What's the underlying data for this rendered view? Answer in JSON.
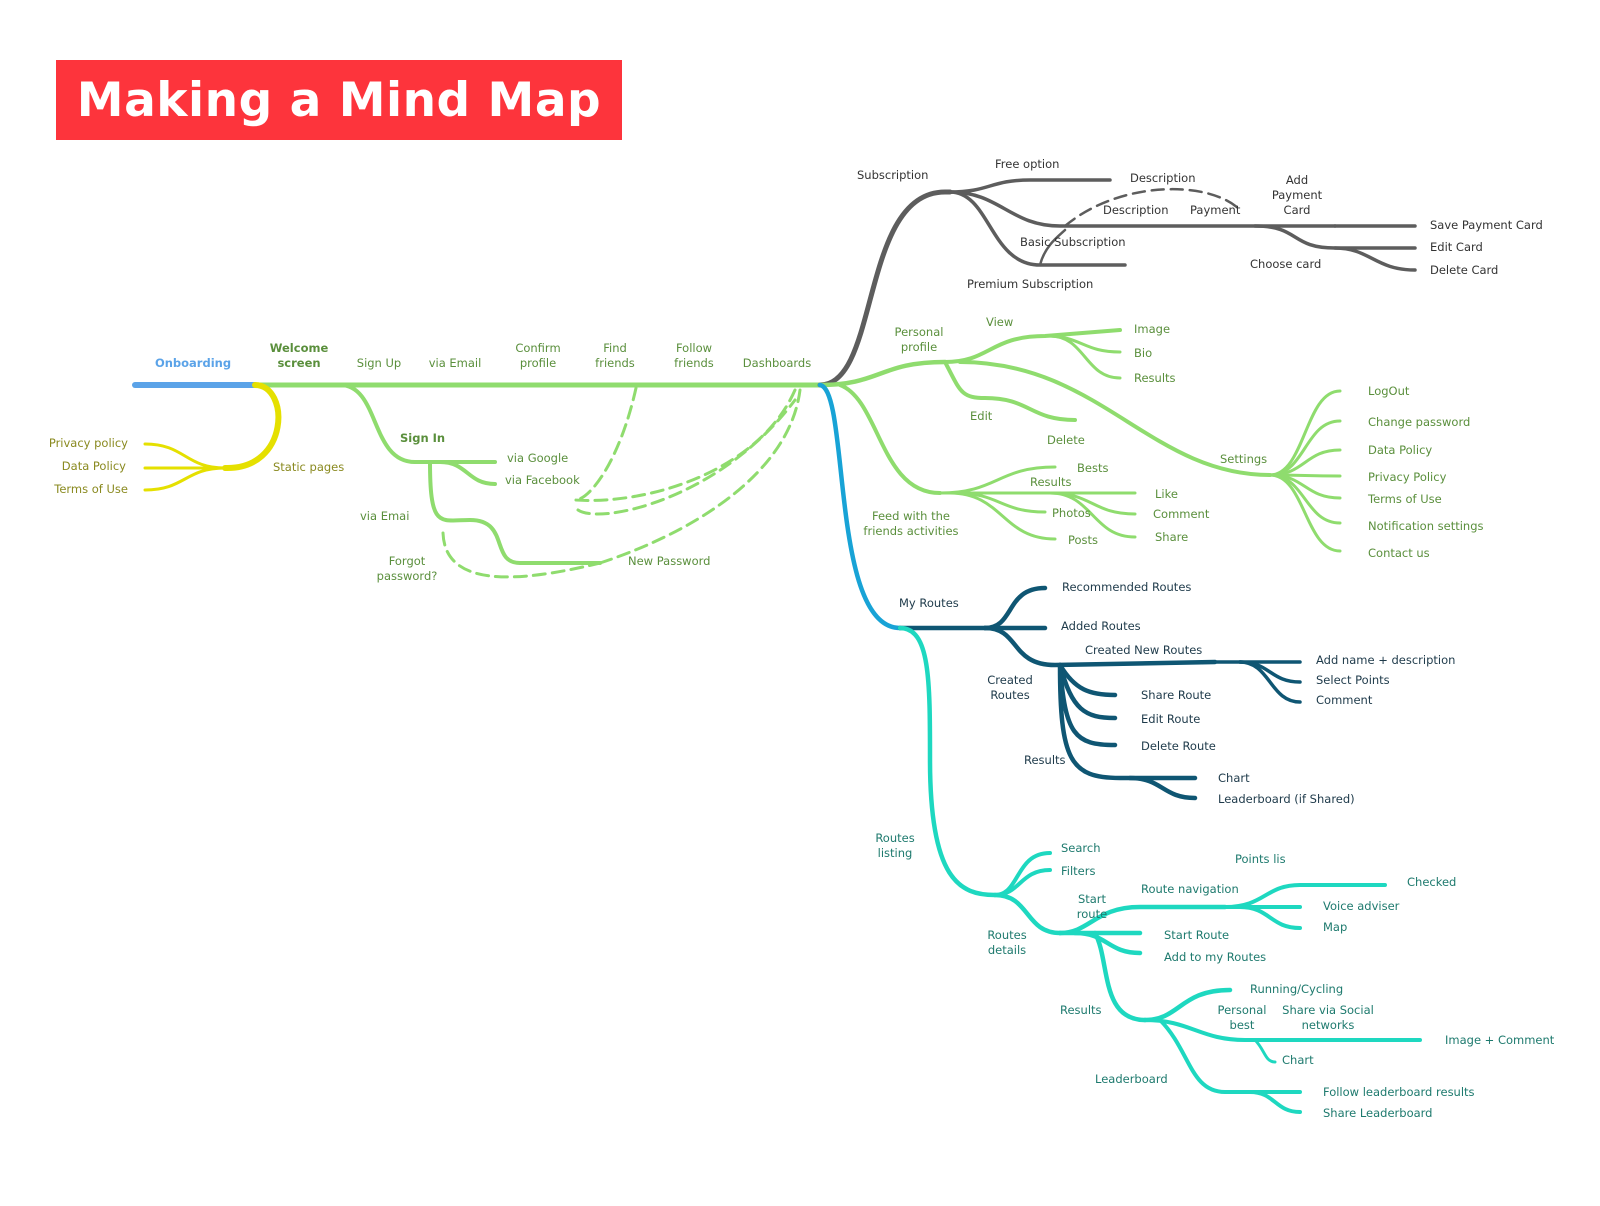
{
  "title": "Making a Mind Map",
  "colors": {
    "banner": "#fd343c",
    "onboarding": "#5ba3e8",
    "static": "#e5e000",
    "static_text": "#8a8a20",
    "green": "#8fdc6e",
    "green_text": "#5a8f3c",
    "gray": "#5d5d5d",
    "gray_text": "#333333",
    "blue": "#18a3d6",
    "navy": "#0f5673",
    "navy_text": "#1e3a4a",
    "teal": "#1ed8c0",
    "teal_text": "#1e7a6e"
  },
  "nodes": {
    "onboarding": "Onboarding",
    "welcome": [
      "Welcome",
      "screen"
    ],
    "sign_up": "Sign Up",
    "via_email": "via Email",
    "confirm": [
      "Confirm",
      "profile"
    ],
    "find": [
      "Find",
      "friends"
    ],
    "follow": [
      "Follow",
      "friends"
    ],
    "dashboards": "Dashboards",
    "static_pages": "Static pages",
    "privacy_policy": "Privacy policy",
    "data_policy": "Data Policy",
    "terms": "Terms of Use",
    "sign_in": "Sign In",
    "via_google": "via Google",
    "via_facebook": "via Facebook",
    "via_emai": "via Emai",
    "forgot": [
      "Forgot",
      "password?"
    ],
    "new_password": "New Password",
    "subscription": "Subscription",
    "free_option": "Free option",
    "description1": "Description",
    "description2": "Description",
    "payment": "Payment",
    "add_payment": [
      "Add",
      "Payment",
      "Card"
    ],
    "basic_sub": "Basic Subscription",
    "premium_sub": "Premium Subscription",
    "choose_card": "Choose card",
    "save_card": "Save Payment Card",
    "edit_card": "Edit Card",
    "delete_card": "Delete Card",
    "personal_profile": [
      "Personal",
      "profile"
    ],
    "view": "View",
    "image": "Image",
    "bio": "Bio",
    "results_pp": "Results",
    "edit": "Edit",
    "delete": "Delete",
    "settings": "Settings",
    "logout": "LogOut",
    "change_password": "Change password",
    "data_policy_s": "Data Policy",
    "privacy_policy_s": "Privacy Policy",
    "terms_s": "Terms of Use",
    "notification": "Notification settings",
    "contact": "Contact us",
    "feed": [
      "Feed with the",
      "friends activities"
    ],
    "bests": "Bests",
    "results_feed": "Results",
    "photos": "Photos",
    "posts": "Posts",
    "like": "Like",
    "comment_feed": "Comment",
    "share_feed": "Share",
    "my_routes": "My Routes",
    "recommended": "Recommended Routes",
    "added": "Added Routes",
    "created_new": "Created New Routes",
    "created_routes": [
      "Created",
      "Routes"
    ],
    "add_name": "Add name + description",
    "select_points": "Select Points",
    "comment_cr": "Comment",
    "share_route": "Share Route",
    "edit_route": "Edit Route",
    "delete_route": "Delete Route",
    "results_mr": "Results",
    "chart_mr": "Chart",
    "leaderboard_shared": "Leaderboard (if Shared)",
    "routes_listing": [
      "Routes",
      "listing"
    ],
    "search": "Search",
    "filters": "Filters",
    "points_lis": "Points lis",
    "route_navigation": "Route navigation",
    "checked": "Checked",
    "voice": "Voice adviser",
    "map": "Map",
    "start_route_lbl": [
      "Start",
      "route"
    ],
    "routes_details": [
      "Routes",
      "details"
    ],
    "start_route": "Start Route",
    "add_to_my": "Add to my Routes",
    "results_rl": "Results",
    "running": "Running/Cycling",
    "personal_best": [
      "Personal",
      "best"
    ],
    "share_social": [
      "Share via Social",
      "networks"
    ],
    "image_comment": "Image + Comment",
    "chart_rl": "Chart",
    "leaderboard": "Leaderboard",
    "follow_lb": "Follow leaderboard results",
    "share_lb": "Share Leaderboard"
  }
}
